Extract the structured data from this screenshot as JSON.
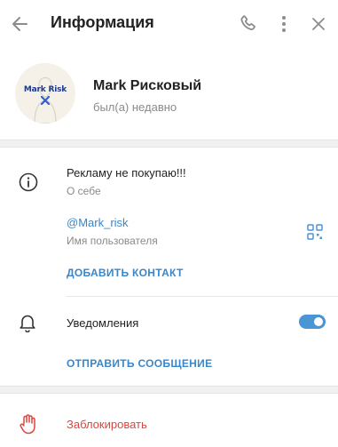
{
  "header": {
    "title": "Информация",
    "icons": {
      "back": "arrow-left-icon",
      "call": "phone-icon",
      "more": "more-vertical-icon",
      "close": "close-icon"
    }
  },
  "profile": {
    "avatar_logo_text": "Mark Risk",
    "name": "Mark Рисковый",
    "status": "был(а) недавно"
  },
  "info": {
    "bio": "Рекламу не покупаю!!!",
    "bio_label": "О себе",
    "username": "@Mark_risk",
    "username_label": "Имя пользователя",
    "add_contact": "ДОБАВИТЬ КОНТАКТ"
  },
  "notifications": {
    "label": "Уведомления",
    "enabled": true,
    "send_message": "ОТПРАВИТЬ СООБЩЕНИЕ"
  },
  "block": {
    "label": "Заблокировать"
  },
  "colors": {
    "accent": "#3a86c8",
    "toggle": "#4a95d6",
    "danger": "#d9463d",
    "muted": "#8a8a8a"
  }
}
